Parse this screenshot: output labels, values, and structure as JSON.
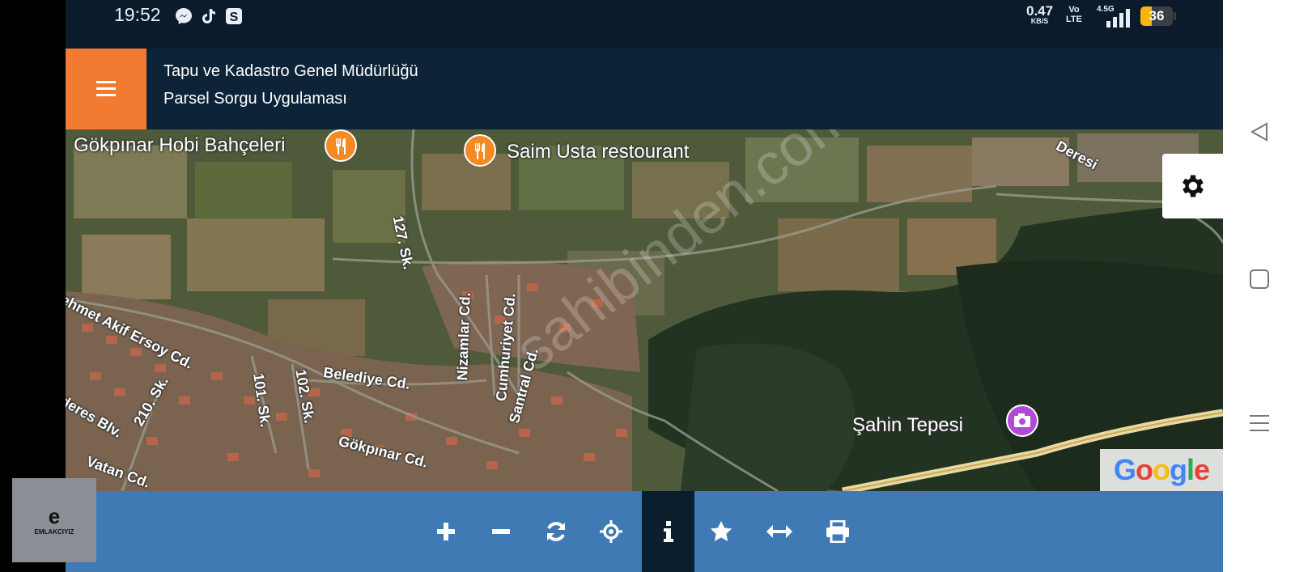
{
  "status_bar": {
    "time": "19:52",
    "app_icons": [
      "messenger-icon",
      "tiktok-icon",
      "s-app-icon"
    ],
    "net_speed_value": "0.47",
    "net_speed_unit": "KB/S",
    "volte_line1": "Vo",
    "volte_line2": "LTE",
    "network_type": "4.5G",
    "battery": "36"
  },
  "header": {
    "title_line1": "Tapu ve Kadastro Genel Müdürlüğü",
    "title_line2": "Parsel Sorgu Uygulaması",
    "accent_color": "#f37a31",
    "background_color": "#0d2438"
  },
  "map": {
    "poi_labels": {
      "hobi": "Gökpınar Hobi Bahçeleri",
      "saim": "Saim Usta restourant",
      "sahin": "Şahin Tepesi"
    },
    "street_labels": {
      "s127": "127. Sk.",
      "akif": "ehmet Akif Ersoy Cd.",
      "nizamlar": "Nizamlar Cd.",
      "cumhuriyet": "Cumhuriyet Cd.",
      "santral": "Santral Cd.",
      "belediye": "Belediye Cd.",
      "s101": "101. Sk.",
      "s102": "102. Sk.",
      "s210": "210. Sk.",
      "deres": "deres Blv.",
      "vatan": "Vatan Cd.",
      "gokpinar": "Gökpınar Cd.",
      "deresi": "Deresi"
    },
    "google_logo": "Google",
    "watermark": "sahibinden.com"
  },
  "toolbar": {
    "buttons": [
      "zoom-in",
      "zoom-out",
      "refresh",
      "locate",
      "info",
      "favorite",
      "measure",
      "print"
    ],
    "background_color": "#3f7ab5",
    "active_color": "#0a1e2e"
  },
  "overlay_logo": {
    "letter": "e",
    "text": "EMLAKCIYIZ"
  }
}
